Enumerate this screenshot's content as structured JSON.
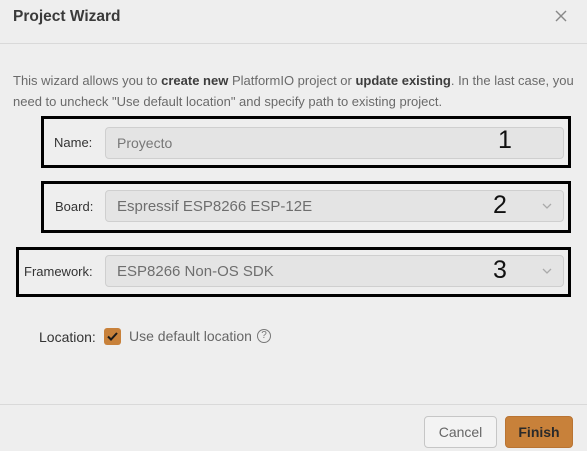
{
  "dialog": {
    "title": "Project Wizard",
    "close_icon": "close-icon"
  },
  "description": {
    "part1": "This wizard allows you to ",
    "bold1": "create new",
    "part2": " PlatformIO project or ",
    "bold2": "update existing",
    "part3": ". In the last case, you need to uncheck \"Use default location\" and specify path to existing project."
  },
  "form": {
    "name": {
      "label": "Name:",
      "value": "Proyecto"
    },
    "board": {
      "label": "Board:",
      "value": "Espressif ESP8266 ESP-12E"
    },
    "framework": {
      "label": "Framework:",
      "value": "ESP8266 Non-OS SDK"
    },
    "location": {
      "label": "Location:",
      "checkbox_label": "Use default location",
      "checked": true,
      "help_icon": "?"
    }
  },
  "annotations": {
    "one": "1",
    "two": "2",
    "three": "3"
  },
  "footer": {
    "cancel_label": "Cancel",
    "finish_label": "Finish"
  },
  "colors": {
    "accent": "#c8813a",
    "background": "#eeeeee"
  }
}
